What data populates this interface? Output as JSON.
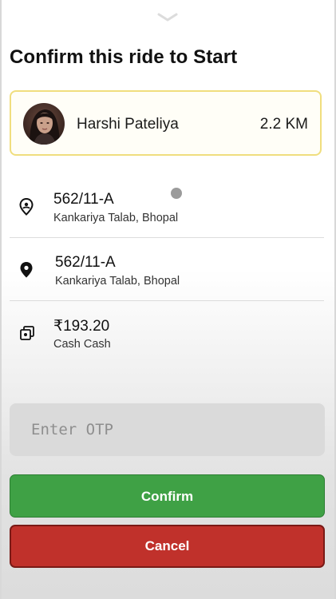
{
  "sheet": {
    "handle_icon": "chevron-down-icon",
    "title": "Confirm this ride to Start"
  },
  "rider": {
    "avatar_icon": "rider-avatar",
    "name": "Harshi Pateliya",
    "distance": "2.2 KM"
  },
  "pickup": {
    "icon": "pickup-pin-icon",
    "address": "562/11-A",
    "locality": "Kankariya Talab, Bhopal"
  },
  "dropoff": {
    "icon": "dropoff-pin-icon",
    "address": "562/11-A",
    "locality": "Kankariya Talab, Bhopal"
  },
  "fare": {
    "icon": "cash-icon",
    "amount": "₹193.20",
    "method": "Cash Cash"
  },
  "otp": {
    "placeholder": "Enter OTP",
    "value": ""
  },
  "actions": {
    "confirm_label": "Confirm",
    "cancel_label": "Cancel"
  },
  "colors": {
    "card_border": "#f0de7e",
    "confirm": "#3fa145",
    "cancel": "#c0312b",
    "otp_bg": "#dadada"
  }
}
